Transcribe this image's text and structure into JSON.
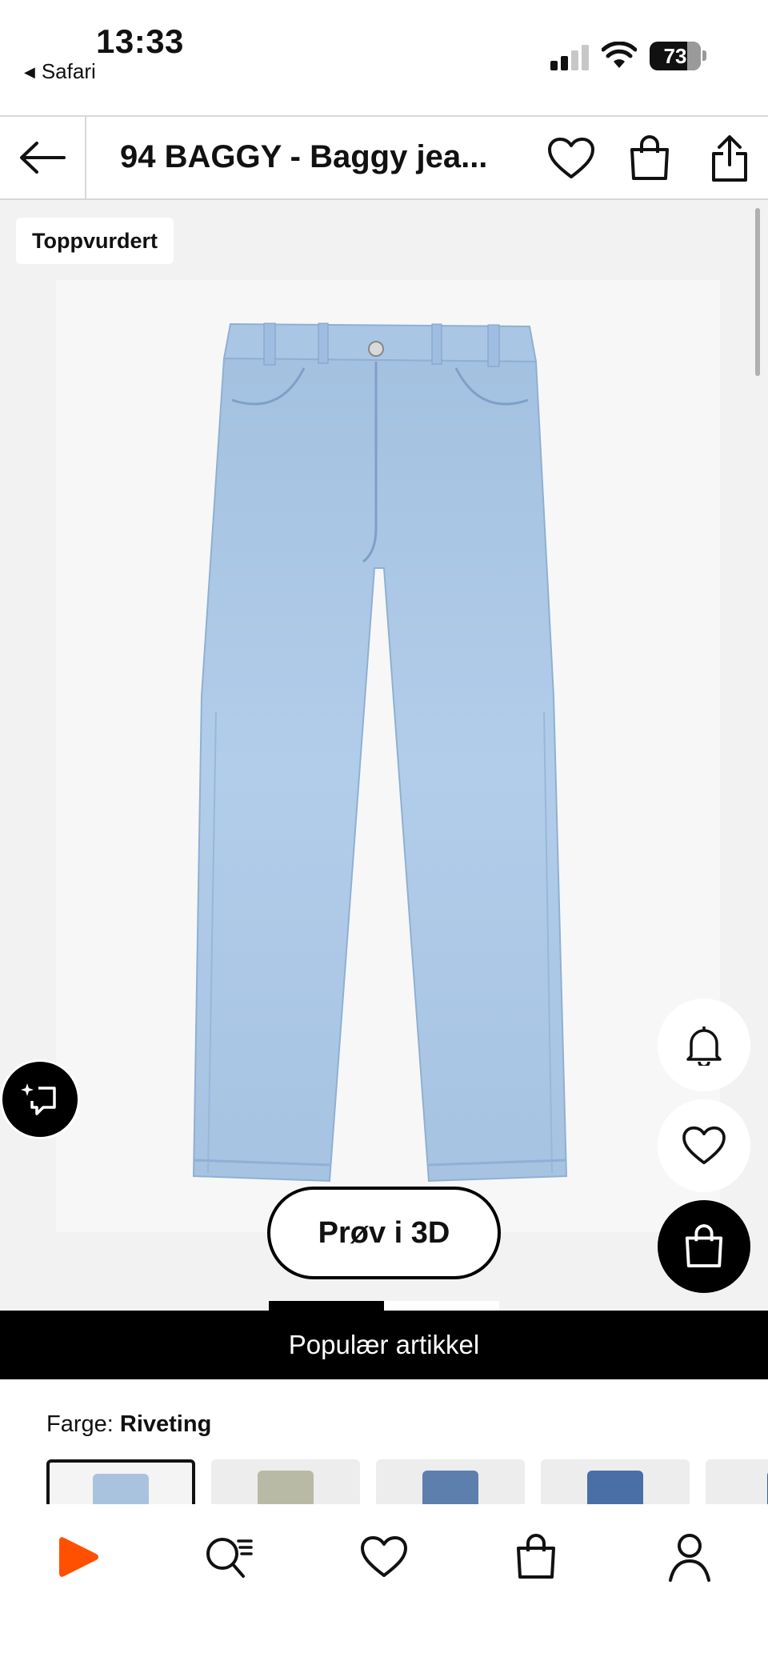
{
  "status_bar": {
    "time": "13:33",
    "back_app": "Safari",
    "battery": "73"
  },
  "header": {
    "title": "94 BAGGY - Baggy jea..."
  },
  "gallery": {
    "badge": "Toppvurdert",
    "try_3d_label": "Prøv i 3D",
    "page_count": 2,
    "current_page": 1
  },
  "banner": {
    "text": "Populær artikkel"
  },
  "color": {
    "label": "Farge:",
    "value": "Riveting",
    "swatches": [
      {
        "name": "Riveting",
        "color": "#a9c3df",
        "selected": true
      },
      {
        "name": "",
        "color": "#b8baa6",
        "selected": false
      },
      {
        "name": "",
        "color": "#5d7fae",
        "selected": false
      },
      {
        "name": "",
        "color": "#4a6fa6",
        "selected": false
      },
      {
        "name": "",
        "color": "#3f6399",
        "selected": false
      }
    ]
  },
  "bottom_nav": {
    "items": [
      "home-logo-icon",
      "search-icon",
      "heart-icon",
      "bag-icon",
      "profile-icon"
    ],
    "brand_color": "#ff4f00"
  },
  "colors": {
    "accent": "#ff4f00",
    "banner_bg": "#000000",
    "gallery_bg": "#f2f2f2",
    "denim": "#a8c4e2"
  }
}
